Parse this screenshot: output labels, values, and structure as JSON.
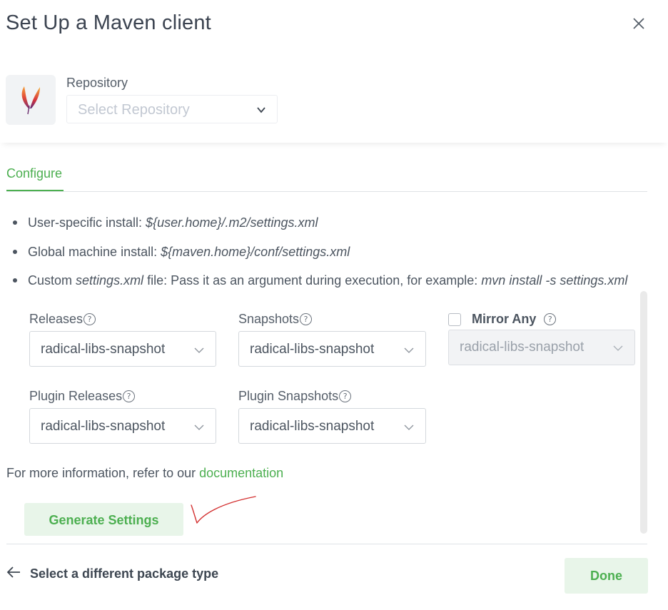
{
  "dialog": {
    "title": "Set Up a Maven client",
    "close_icon": "close-icon"
  },
  "repository": {
    "label": "Repository",
    "placeholder": "Select Repository",
    "logo_icon": "apache-maven-feather-icon"
  },
  "tabs": [
    {
      "label": "Configure",
      "active": true
    }
  ],
  "instructions": [
    {
      "prefix": "User-specific install: ",
      "italic": "${user.home}/.m2/settings.xml",
      "middle": "",
      "italic2": ""
    },
    {
      "prefix": "Global machine install: ",
      "italic": "${maven.home}/conf/settings.xml",
      "middle": "",
      "italic2": ""
    },
    {
      "prefix": "Custom ",
      "italic": "settings.xml",
      "middle": " file: Pass it as an argument during execution, for example: ",
      "italic2": "mvn install -s settings.xml"
    }
  ],
  "fields": {
    "releases": {
      "label": "Releases",
      "value": "radical-libs-snapshot"
    },
    "snapshots": {
      "label": "Snapshots",
      "value": "radical-libs-snapshot"
    },
    "mirror_any": {
      "label": "Mirror Any",
      "checked": false,
      "value": "radical-libs-snapshot"
    },
    "plugin_releases": {
      "label": "Plugin Releases",
      "value": "radical-libs-snapshot"
    },
    "plugin_snapshots": {
      "label": "Plugin Snapshots",
      "value": "radical-libs-snapshot"
    }
  },
  "help_glyph": "?",
  "more_info": {
    "text": "For more information, refer to our ",
    "link": "documentation"
  },
  "generate_button": "Generate Settings",
  "footer": {
    "back_label": "Select a different package type",
    "done_label": "Done"
  },
  "colors": {
    "accent": "#4caf50",
    "accent_bg": "#e8f5e9",
    "annotation": "#d32f2f"
  }
}
